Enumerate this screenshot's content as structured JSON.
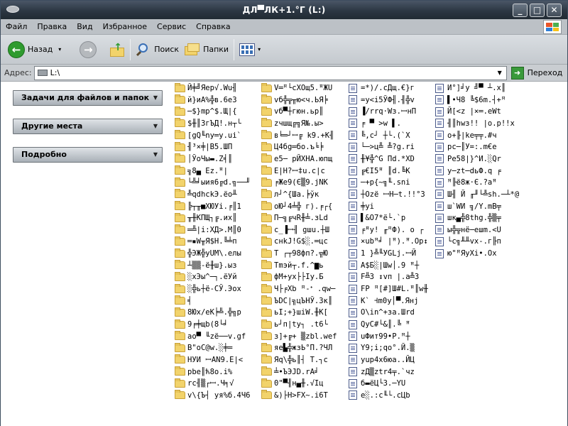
{
  "window": {
    "title": "ДЛ▀ЛК+1.°Г (L:)"
  },
  "menu": [
    "Файл",
    "Правка",
    "Вид",
    "Избранное",
    "Сервис",
    "Справка"
  ],
  "toolbar": {
    "back": "Назад",
    "search": "Поиск",
    "folders": "Папки"
  },
  "address": {
    "label": "Адрес:",
    "value": "L:\\",
    "go": "Переход"
  },
  "sidebar": {
    "tasks": "Задачи для файлов и папок",
    "places": "Другие места",
    "details": "Подробно"
  },
  "colors": {
    "title_bar": "#2c3743",
    "menu_bar": "#bcc1c6",
    "folder": "#f2d36b"
  },
  "columns": [
    {
      "type": "folder",
      "items": [
        "Й╪╝Яер√.Wu╢",
        "й}иА%╬в.6е3",
        "─$}mp^$.Щ|{",
        "$╫║ЗгЪД!.н┬└",
        "[gQ╙ny═у.ui`",
        "╢³×╪|В5.ШП",
        "│ЎоЧы▬.Z╡║",
        "╗8▄ Ez.ꟸ|",
        "└╩╛ыия6╔d.╗──╜",
        "╩qdhckЭ.ёо╨",
        "╠┬╥■ХЮУі.╒║1",
        "╥╫КПЩ┐╔.их║",
        "═╩|і:ХД>.М║0",
        "═▪W╥Я$Н.╚╧п",
        "╬ЭЖ╬уUM\\.елы",
        "┴▒▒-ё╫ш}.ыз",
        "░хЭы^─┐.ёУй",
        "░╬ь┼ё-СЎ.Эох",
        "╡",
        "8Юх/еК╞╩.╬╗р",
        "9╒╪щb(8└╛",
        "ао▀ ╙zё──v.gf",
        "В\"оС@w.░╪═",
        "НУИ ꟷАN9.Е|<",
        "pbe║ћ8о.і%",
        "rc╢▒┌ꟷ.Ч╕√",
        "v\\{Ъ┤ уя%б.4Ч6"
      ]
    },
    {
      "type": "folder",
      "items": [
        "V═ꟸ└сХОщ5.ꟸЖU",
        "vб╬╦╥ю<ч.ЬЯ╞",
        "vб▀┼гюн.ьр║",
        "zчшщ╔╗Я№.ы>",
        "в╘═┘ꟷ╔ k9.+К╢",
        "Ц4бg═бо.ъ╘╞",
        "е5─ рЙХНА.юпщ",
        "Е|Н?ꟷ‡u.с|с",
        "╒Же9(Є▒9.jNK",
        "л┘^{Шa.╞ўк",
        "оЮ┘4╧╬ г).╒┌{",
        "П─╗╔чR╫╧.зLd",
        "с_▐ꟷ╢ gшu.┼Ш",
        "снkJ!G$░.═цс",
        "Т ┌┬98фп?.╦Ю",
        "Tmэй┬.f.^▆ь",
        "фМ+ух├├Іу.Б",
        "Ч├╒Xb ꟸ-ᐩ .qw─",
        "ЪDC|╗цЪНЎ.Зк║",
        "ьI;+}шіW.╫К[",
        "ь┘п|ty┐ .t6└",
        "з]+╔+ ▒zbl.wef",
        "яе▙╬жзЬ°П.?ЧЛ",
        "Яq\\╬ь║┤ T.┐с",
        "╧•ЪЭJD.rА╛",
        "0\"▀╢н▄╫.√Іц",
        "&)├Н>FХ~.і6Т"
      ]
    },
    {
      "type": "file",
      "items": [
        "=*)/.сДщ.€}г",
        "=у<і5ЎФ╢.╢╬v",
        "▐/rrq·Wз.ꟷнП",
        "╒ ▀ >w ▌.",
        "╚,с┘ ┼└.(`Х",
        "└─>ц╩ ╩?g.ri",
        "╫¥╬^G Пd.*XD",
        "╔€I5ꟸ ║d.╚К",
        "─+р{~╗╙.snі",
        "┼Оzё ꟷН─t.!!°3",
        "╪уі",
        "▌&O7*ё└.`р",
        "╒ꟸу! ╓ꟸФ). о ┌",
        "×ubꟸ╛ |ꟸ).ꟸ.Ор↕",
        "1 }╩╙УGLj.ꟷЙ",
        "А$Б░|Шw│.9 ꟸ┼",
        "F╩3 ↕vп |.а╩3",
        "FP ꟸ[#]Ш#L.ꟸ║w╫",
        "К` Ꟶm0у│▀.Янj",
        "О\\іn^+за.Шrd",
        "QyC#└&║.╚ ꟸ",
        "uФит99•Р.ꟸ┼",
        "Y9;і;qo°.Й.▒",
        "yup4х6юа..ЙЦ",
        "zД▒ztr4╤.`чz",
        "б▬ёЦ└З.─YU",
        "е░.:с╙└.сЦb"
      ]
    },
    {
      "type": "file",
      "items": [
        "И°]╛у ╝▀ ┴.х║",
        "▌•Ч8 ╚$6m.┤+ꟸ",
        "Й[<z |×═.еWt",
        "╢║hwз!! |о.р!!х",
        "о+╟|ke╤╤.#ч",
        "pc─║У=:.m€е",
        "Pe58|}^И.░Qr",
        "у─zt─dьФ.q ╒",
        "ꟸ╟ё8ж·Є.?aꟸ",
        "Ш╢ Й ╓╜└╩sh.─┴*@",
        "ш`WИ ╗/Y.mB╤",
        "шк▄╬8thg.╬▒╤",
        "ы╬╦нё─ешm.<U",
        "└с╗╨╨vх-.г╟п",
        "ю\"ꟸЯуХі•.Ох"
      ]
    }
  ]
}
